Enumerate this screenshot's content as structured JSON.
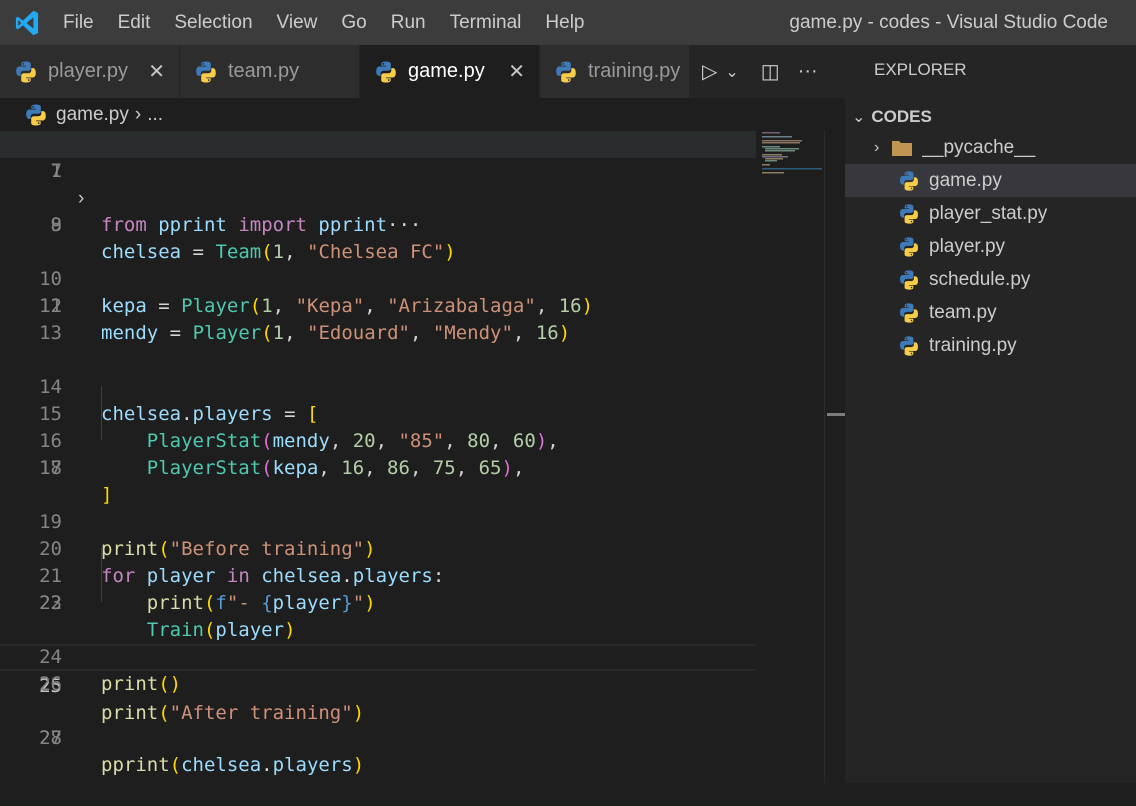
{
  "window": {
    "title": "game.py - codes - Visual Studio Code"
  },
  "menu": [
    "File",
    "Edit",
    "Selection",
    "View",
    "Go",
    "Run",
    "Terminal",
    "Help"
  ],
  "tabs": [
    {
      "label": "player.py",
      "active": false,
      "close": "✕"
    },
    {
      "label": "team.py",
      "active": false
    },
    {
      "label": "game.py",
      "active": true,
      "close": "✕"
    },
    {
      "label": "training.py",
      "active": false
    }
  ],
  "tab_actions": {
    "run": "▷",
    "dropdown": "⌄",
    "split": "◫",
    "more": "···"
  },
  "breadcrumb": {
    "file": "game.py",
    "sep": "›",
    "more": "..."
  },
  "editor": {
    "current_line": 25,
    "lines": [
      {
        "n": "1",
        "text": "from pprint import pprint···"
      },
      {
        "n": "7",
        "text": ""
      },
      {
        "n": "8",
        "text": "chelsea = Team(1, \"Chelsea FC\")"
      },
      {
        "n": "9",
        "text": ""
      },
      {
        "n": "10",
        "text": "kepa = Player(1, \"Kepa\", \"Arizabalaga\", 16)"
      },
      {
        "n": "11",
        "text": "mendy = Player(1, \"Edouard\", \"Mendy\", 16)"
      },
      {
        "n": "12",
        "text": ""
      },
      {
        "n": "13",
        "text": ""
      },
      {
        "n": "14",
        "text": "chelsea.players = ["
      },
      {
        "n": "15",
        "text": "    PlayerStat(mendy, 20, \"85\", 80, 60),"
      },
      {
        "n": "16",
        "text": "    PlayerStat(kepa, 16, 86, 75, 65),"
      },
      {
        "n": "17",
        "text": "]"
      },
      {
        "n": "18",
        "text": ""
      },
      {
        "n": "19",
        "text": "print(\"Before training\")"
      },
      {
        "n": "20",
        "text": "for player in chelsea.players:"
      },
      {
        "n": "21",
        "text": "    print(f\"- {player}\")"
      },
      {
        "n": "22",
        "text": "    Train(player)"
      },
      {
        "n": "23",
        "text": ""
      },
      {
        "n": "24",
        "text": "print()"
      },
      {
        "n": "25",
        "text": "print(\"After training\")"
      },
      {
        "n": "26",
        "text": ""
      },
      {
        "n": "27",
        "text": "pprint(chelsea.players)"
      },
      {
        "n": "28",
        "text": ""
      }
    ]
  },
  "explorer": {
    "title": "EXPLORER",
    "section": "CODES",
    "folder": "__pycache__",
    "files": [
      {
        "name": "game.py",
        "selected": true
      },
      {
        "name": "player_stat.py",
        "selected": false
      },
      {
        "name": "player.py",
        "selected": false
      },
      {
        "name": "schedule.py",
        "selected": false
      },
      {
        "name": "team.py",
        "selected": false
      },
      {
        "name": "training.py",
        "selected": false
      }
    ]
  },
  "colors": {
    "accent": "#007acc",
    "keyword": "#c586c0",
    "string": "#ce9178",
    "number": "#b5cea8",
    "class": "#4ec9b0",
    "function": "#dcdcaa",
    "variable": "#9cdcfe"
  }
}
